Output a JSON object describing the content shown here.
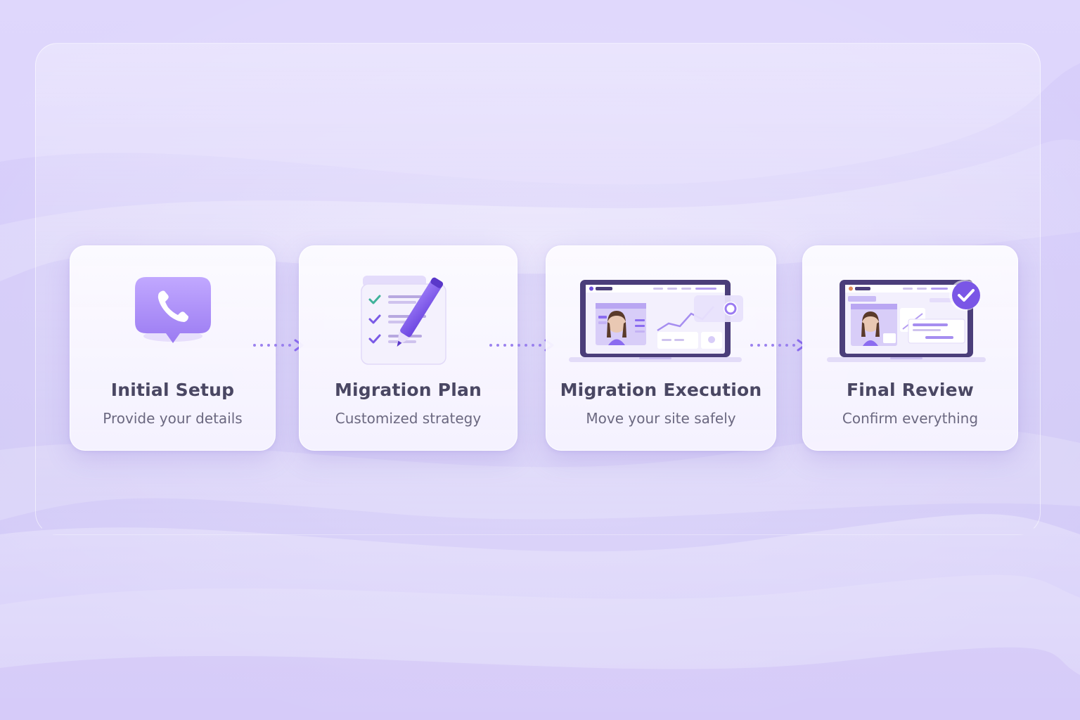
{
  "steps": [
    {
      "title": "Initial Setup",
      "subtitle": "Provide your details",
      "icon": "phone-chat-icon"
    },
    {
      "title": "Migration Plan",
      "subtitle": "Customized strategy",
      "icon": "checklist-pencil-icon"
    },
    {
      "title": "Migration Execution",
      "subtitle": "Move your site safely",
      "icon": "laptop-dashboard-icon"
    },
    {
      "title": "Final Review",
      "subtitle": "Confirm everything",
      "icon": "laptop-check-icon"
    }
  ],
  "colors": {
    "accent": "#8b6cf0",
    "accent_dark": "#6b4bd8",
    "title": "#4a4763",
    "subtitle": "#6b6880",
    "background": "#d6cdfa"
  }
}
